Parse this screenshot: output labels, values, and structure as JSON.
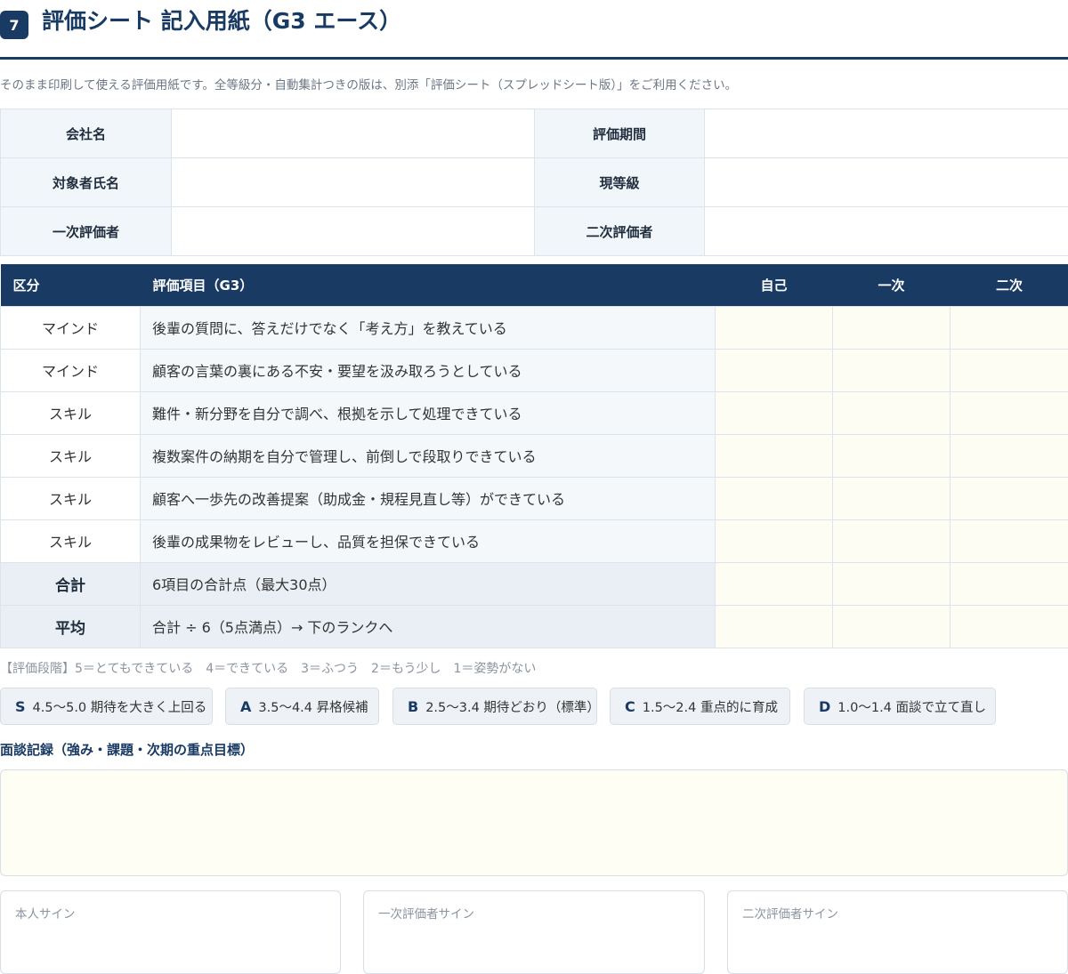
{
  "header": {
    "section_number": "7",
    "title": "評価シート 記入用紙（G3 エース）"
  },
  "description": "そのまま印刷して使える評価用紙です。全等級分・自動集計つきの版は、別添「評価シート（スプレッドシート版）」をご利用ください。",
  "info_fields": {
    "company": "会社名",
    "period": "評価期間",
    "employee": "対象者氏名",
    "grade": "現等級",
    "first_evaluator": "一次評価者",
    "second_evaluator": "二次評価者"
  },
  "eval_table": {
    "headers": {
      "category": "区分",
      "item": "評価項目（G3）",
      "self": "自己",
      "first": "一次",
      "second": "二次"
    },
    "rows": [
      {
        "category": "マインド",
        "item": "後輩の質問に、答えだけでなく「考え方」を教えている"
      },
      {
        "category": "マインド",
        "item": "顧客の言葉の裏にある不安・要望を汲み取ろうとしている"
      },
      {
        "category": "スキル",
        "item": "難件・新分野を自分で調べ、根拠を示して処理できている"
      },
      {
        "category": "スキル",
        "item": "複数案件の納期を自分で管理し、前倒しで段取りできている"
      },
      {
        "category": "スキル",
        "item": "顧客へ一歩先の改善提案（助成金・規程見直し等）ができている"
      },
      {
        "category": "スキル",
        "item": "後輩の成果物をレビューし、品質を担保できている"
      }
    ],
    "total": {
      "label": "合計",
      "item": "6項目の合計点（最大30点）"
    },
    "average": {
      "label": "平均",
      "item": "合計 ÷ 6（5点満点）→ 下のランクへ"
    }
  },
  "scale": "【評価段階】5＝とてもできている　4＝できている　3＝ふつう　2＝もう少し　1＝姿勢がない",
  "ranks": [
    {
      "letter": "S",
      "text": "4.5〜5.0 期待を大きく上回る"
    },
    {
      "letter": "A",
      "text": "3.5〜4.4 昇格候補"
    },
    {
      "letter": "B",
      "text": "2.5〜3.4 期待どおり（標準）"
    },
    {
      "letter": "C",
      "text": "1.5〜2.4 重点的に育成"
    },
    {
      "letter": "D",
      "text": "1.0〜1.4 面談で立て直し"
    }
  ],
  "memo": {
    "title": "面談記録（強み・課題・次期の重点目標）"
  },
  "signatures": {
    "self": "本人サイン",
    "first": "一次評価者サイン",
    "second": "二次評価者サイン"
  },
  "colors": {
    "navy": "#183a63",
    "label_bg": "#f1f6fa",
    "score_bg": "#fdfdf3",
    "border": "#dbe3ec"
  }
}
